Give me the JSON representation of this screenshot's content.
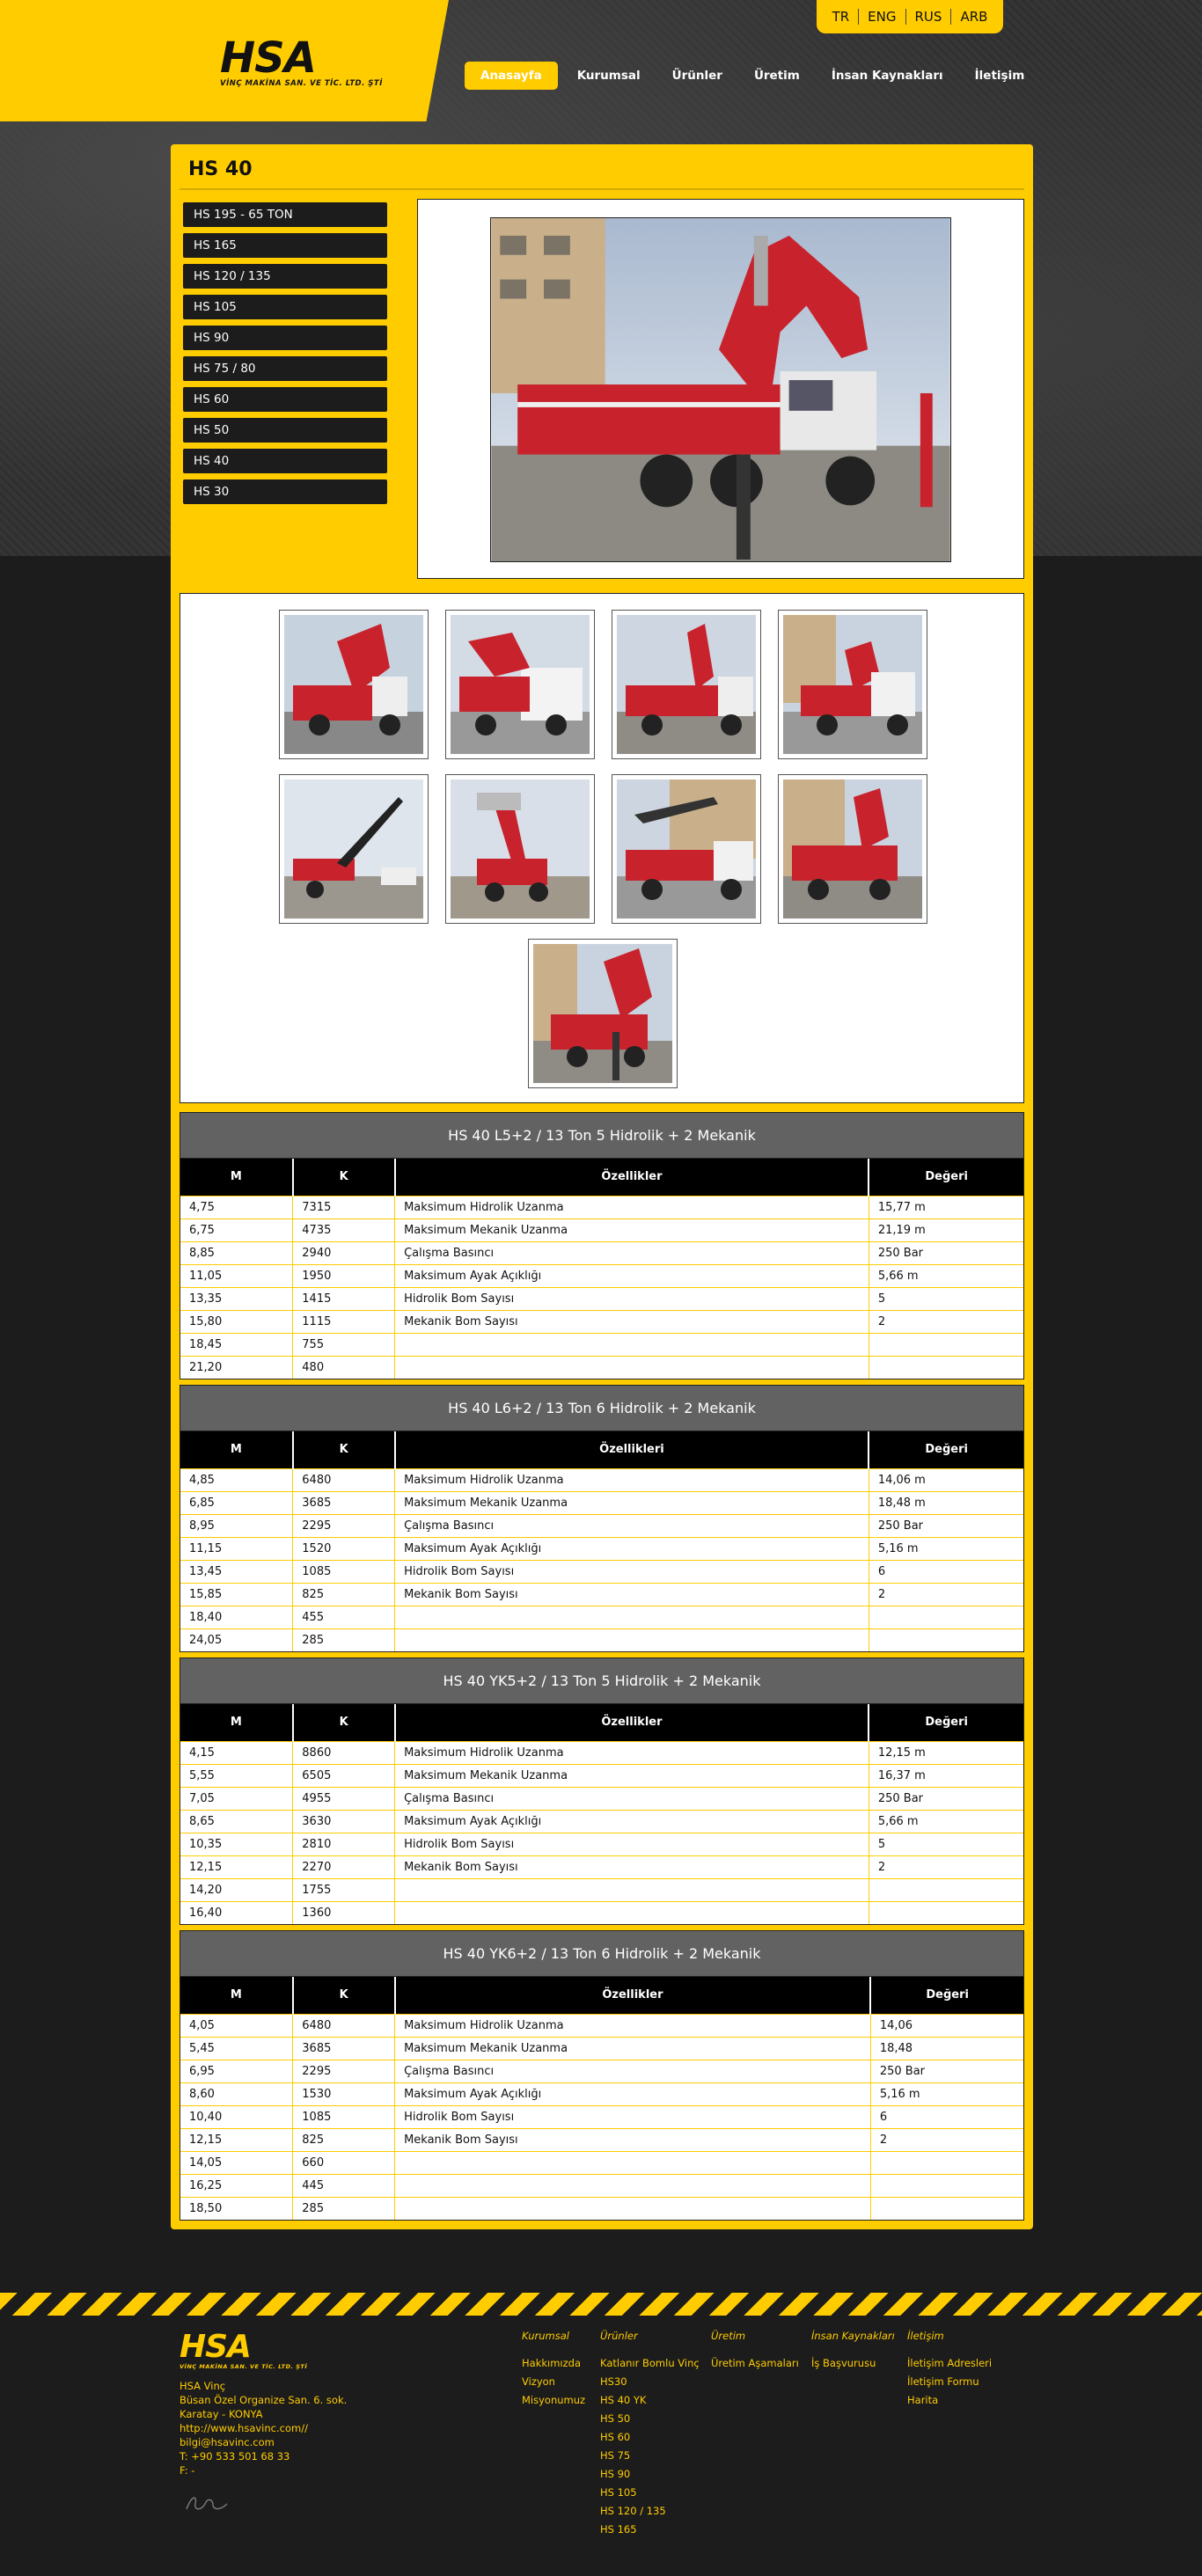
{
  "header": {
    "logo_text": "HSA",
    "logo_sub": "VİNÇ MAKİNA SAN. VE TİC. LTD. ŞTİ",
    "languages": [
      "TR",
      "ENG",
      "RUS",
      "ARB"
    ],
    "nav": [
      "Anasayfa",
      "Kurumsal",
      "Ürünler",
      "Üretim",
      "İnsan Kaynakları",
      "İletişim"
    ],
    "active_nav": "Anasayfa"
  },
  "page": {
    "title": "HS 40",
    "side_menu": [
      "HS 195 - 65 TON",
      "HS 165",
      "HS 120 / 135",
      "HS 105",
      "HS 90",
      "HS 75 / 80",
      "HS 60",
      "HS 50",
      "HS 40",
      "HS 30"
    ]
  },
  "tables": [
    {
      "caption": "HS 40 L5+2 / 13 Ton 5 Hidrolik + 2 Mekanik",
      "headers": [
        "M",
        "K",
        "Özellikler",
        "Değeri"
      ],
      "rows": [
        [
          "4,75",
          "7315",
          "Maksimum Hidrolik Uzanma",
          "15,77 m"
        ],
        [
          "6,75",
          "4735",
          "Maksimum Mekanik Uzanma",
          "21,19 m"
        ],
        [
          "8,85",
          "2940",
          "Çalışma Basıncı",
          "250 Bar"
        ],
        [
          "11,05",
          "1950",
          "Maksimum Ayak Açıklığı",
          "5,66 m"
        ],
        [
          "13,35",
          "1415",
          "Hidrolik Bom Sayısı",
          "5"
        ],
        [
          "15,80",
          "1115",
          "Mekanik Bom Sayısı",
          "2"
        ],
        [
          "18,45",
          "755",
          "",
          ""
        ],
        [
          "21,20",
          "480",
          "",
          ""
        ]
      ]
    },
    {
      "caption": "HS 40 L6+2 / 13 Ton 6 Hidrolik + 2 Mekanik",
      "headers": [
        "M",
        "K",
        "Özellikleri",
        "Değeri"
      ],
      "rows": [
        [
          "4,85",
          "6480",
          "Maksimum Hidrolik Uzanma",
          "14,06 m"
        ],
        [
          "6,85",
          "3685",
          "Maksimum Mekanik Uzanma",
          "18,48 m"
        ],
        [
          "8,95",
          "2295",
          "Çalışma Basıncı",
          "250 Bar"
        ],
        [
          "11,15",
          "1520",
          "Maksimum Ayak Açıklığı",
          "5,16 m"
        ],
        [
          "13,45",
          "1085",
          "Hidrolik Bom Sayısı",
          "6"
        ],
        [
          "15,85",
          "825",
          "Mekanik Bom Sayısı",
          "2"
        ],
        [
          "18,40",
          "455",
          "",
          ""
        ],
        [
          "24,05",
          "285",
          "",
          ""
        ]
      ]
    },
    {
      "caption": "HS 40 YK5+2 / 13 Ton 5 Hidrolik + 2 Mekanik",
      "headers": [
        "M",
        "K",
        "Özellikler",
        "Değeri"
      ],
      "rows": [
        [
          "4,15",
          "8860",
          "Maksimum Hidrolik Uzanma",
          "12,15 m"
        ],
        [
          "5,55",
          "6505",
          "Maksimum Mekanik Uzanma",
          "16,37 m"
        ],
        [
          "7,05",
          "4955",
          "Çalışma Basıncı",
          "250 Bar"
        ],
        [
          "8,65",
          "3630",
          "Maksimum Ayak Açıklığı",
          "5,66 m"
        ],
        [
          "10,35",
          "2810",
          "Hidrolik Bom Sayısı",
          "5"
        ],
        [
          "12,15",
          "2270",
          "Mekanik Bom Sayısı",
          "2"
        ],
        [
          "14,20",
          "1755",
          "",
          ""
        ],
        [
          "16,40",
          "1360",
          "",
          ""
        ]
      ]
    },
    {
      "caption": "HS 40 YK6+2 / 13 Ton 6 Hidrolik + 2 Mekanik",
      "headers": [
        "M",
        "K",
        "Özellikler",
        "Değeri"
      ],
      "rows": [
        [
          "4,05",
          "6480",
          "Maksimum Hidrolik Uzanma",
          "14,06"
        ],
        [
          "5,45",
          "3685",
          "Maksimum Mekanik Uzanma",
          "18,48"
        ],
        [
          "6,95",
          "2295",
          "Çalışma Basıncı",
          "250 Bar"
        ],
        [
          "8,60",
          "1530",
          "Maksimum Ayak Açıklığı",
          "5,16 m"
        ],
        [
          "10,40",
          "1085",
          "Hidrolik Bom Sayısı",
          "6"
        ],
        [
          "12,15",
          "825",
          "Mekanik Bom Sayısı",
          "2"
        ],
        [
          "14,05",
          "660",
          "",
          ""
        ],
        [
          "16,25",
          "445",
          "",
          ""
        ],
        [
          "18,50",
          "285",
          "",
          ""
        ]
      ]
    }
  ],
  "footer": {
    "logo_text": "HSA",
    "logo_sub": "VİNÇ MAKİNA SAN. VE TİC. LTD. ŞTİ",
    "address": [
      "HSA Vinç",
      "Büsan Özel Organize San. 6. sok.",
      "Karatay - KONYA",
      "http://www.hsavinc.com//",
      "bilgi@hsavinc.com",
      "T: +90 533 501 68 33",
      "F: -"
    ],
    "columns": [
      {
        "title": "Kurumsal",
        "items": [
          "Hakkımızda",
          "Vizyon",
          "Misyonumuz"
        ]
      },
      {
        "title": "Ürünler",
        "items": [
          "Katlanır Bomlu Vinç",
          "HS30",
          "HS 40 YK",
          "HS 50",
          "HS 60",
          "HS 75",
          "HS 90",
          "HS 105",
          "HS 120 / 135",
          "HS 165"
        ]
      },
      {
        "title": "Üretim",
        "items": [
          "Üretim Aşamaları"
        ]
      },
      {
        "title": "İnsan Kaynakları",
        "items": [
          "İş Başvurusu"
        ]
      },
      {
        "title": "İletişim",
        "items": [
          "İletişim Adresleri",
          "İletişim Formu",
          "Harita"
        ]
      }
    ]
  },
  "colors": {
    "accent": "#ffcc00",
    "dark": "#1c1c1c",
    "crane_red": "#c8232c"
  }
}
